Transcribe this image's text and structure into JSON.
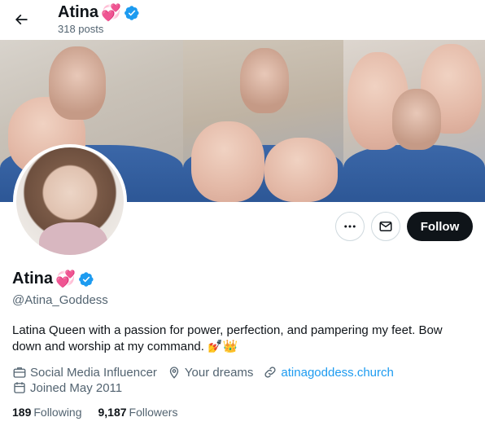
{
  "header": {
    "name": "Atina",
    "name_emoji": "💞",
    "posts": "318 posts"
  },
  "profile": {
    "display_name": "Atina",
    "name_emoji": "💞",
    "handle": "@Atina_Goddess",
    "bio": "Latina Queen with a passion for power, perfection, and pampering my feet. Bow down and worship at my command. 💅👑",
    "category": "Social Media Influencer",
    "location": "Your dreams",
    "website": "atinagoddess.church",
    "joined": "Joined May 2011",
    "following_count": "189",
    "following_label": "Following",
    "followers_count": "9,187",
    "followers_label": "Followers"
  },
  "actions": {
    "follow_label": "Follow"
  },
  "icons": {
    "back": "arrow-left-icon",
    "more": "more-horizontal-icon",
    "message": "envelope-icon",
    "verified": "verified-badge-icon",
    "category": "briefcase-icon",
    "location": "map-pin-icon",
    "website": "link-icon",
    "joined": "calendar-icon"
  },
  "colors": {
    "accent": "#1d9bf0",
    "text": "#0f1419",
    "secondary": "#536471",
    "button_dark": "#0f1419"
  }
}
